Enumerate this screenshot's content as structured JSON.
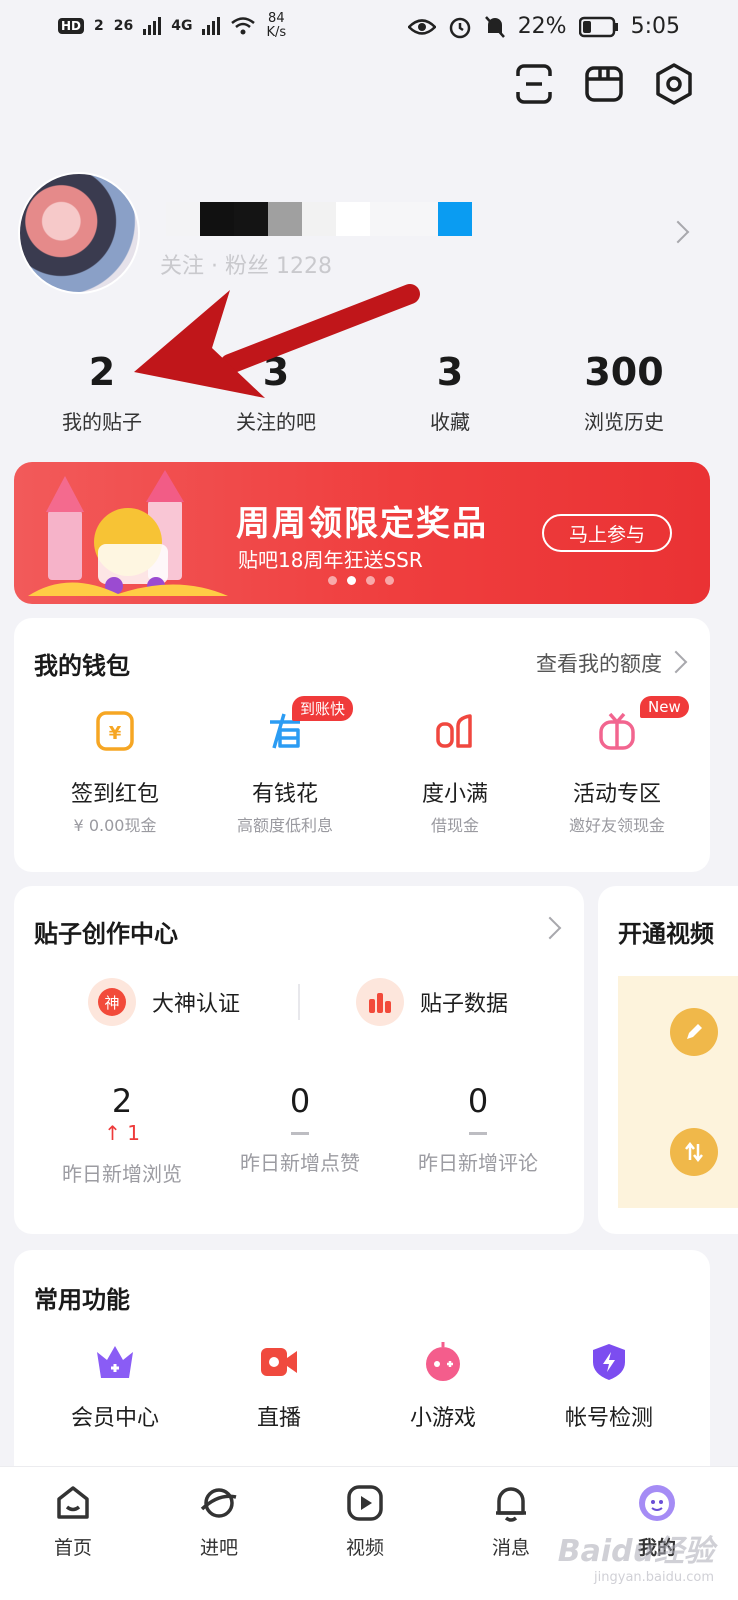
{
  "status_bar": {
    "hd_badge": "HD",
    "sim_slot": "2",
    "net1": "26",
    "net2": "4G",
    "speed_value": "84",
    "speed_unit": "K/s",
    "battery": "22%",
    "time": "5:05"
  },
  "profile": {
    "follow_text": "关注 · 粉丝 1228"
  },
  "stats": [
    {
      "value": "2",
      "label": "我的贴子"
    },
    {
      "value": "3",
      "label": "关注的吧"
    },
    {
      "value": "3",
      "label": "收藏"
    },
    {
      "value": "300",
      "label": "浏览历史"
    }
  ],
  "banner": {
    "title": "周周领限定奖品",
    "subtitle": "贴吧18周年狂送SSR",
    "button": "马上参与",
    "active_dot": 1
  },
  "wallet": {
    "title": "我的钱包",
    "more": "查看我的额度",
    "items": [
      {
        "name": "签到红包",
        "desc": "¥ 0.00现金",
        "tag": "",
        "icon": "yuan-card-icon"
      },
      {
        "name": "有钱花",
        "desc": "高额度低利息",
        "tag": "到账快",
        "icon": "youqianhua-icon"
      },
      {
        "name": "度小满",
        "desc": "借现金",
        "tag": "",
        "icon": "duxiaoman-icon"
      },
      {
        "name": "活动专区",
        "desc": "邀好友领现金",
        "tag": "New",
        "icon": "gift-icon"
      }
    ]
  },
  "creation": {
    "title": "贴子创作中心",
    "certify": "大神认证",
    "certify_badge": "神",
    "post_data": "贴子数据",
    "stats": [
      {
        "value": "2",
        "delta": "1",
        "label": "昨日新增浏览"
      },
      {
        "value": "0",
        "delta": "",
        "label": "昨日新增点赞"
      },
      {
        "value": "0",
        "delta": "",
        "label": "昨日新增评论"
      }
    ]
  },
  "video_card": {
    "title": "开通视频"
  },
  "common": {
    "title": "常用功能",
    "items": [
      {
        "name": "会员中心",
        "icon": "crown-icon",
        "color": "#8a5cf5"
      },
      {
        "name": "直播",
        "icon": "live-camera-icon",
        "color": "#f04a3e"
      },
      {
        "name": "小游戏",
        "icon": "game-icon",
        "color": "#f45d8c"
      },
      {
        "name": "帐号检测",
        "icon": "shield-icon",
        "color": "#7c4df0"
      }
    ]
  },
  "nav": [
    {
      "label": "首页",
      "icon": "home-icon"
    },
    {
      "label": "进吧",
      "icon": "planet-icon"
    },
    {
      "label": "视频",
      "icon": "video-play-icon"
    },
    {
      "label": "消息",
      "icon": "bell-icon"
    },
    {
      "label": "我的",
      "icon": "my-avatar-icon"
    }
  ],
  "watermark": {
    "brand": "Baidu经验",
    "domain": "jingyan.baidu.com"
  },
  "colors": {
    "accent_red": "#ef3e3e",
    "banner_bg": "#f0494a",
    "wallet_orange": "#f6a623",
    "link_blue": "#1da1f2"
  }
}
